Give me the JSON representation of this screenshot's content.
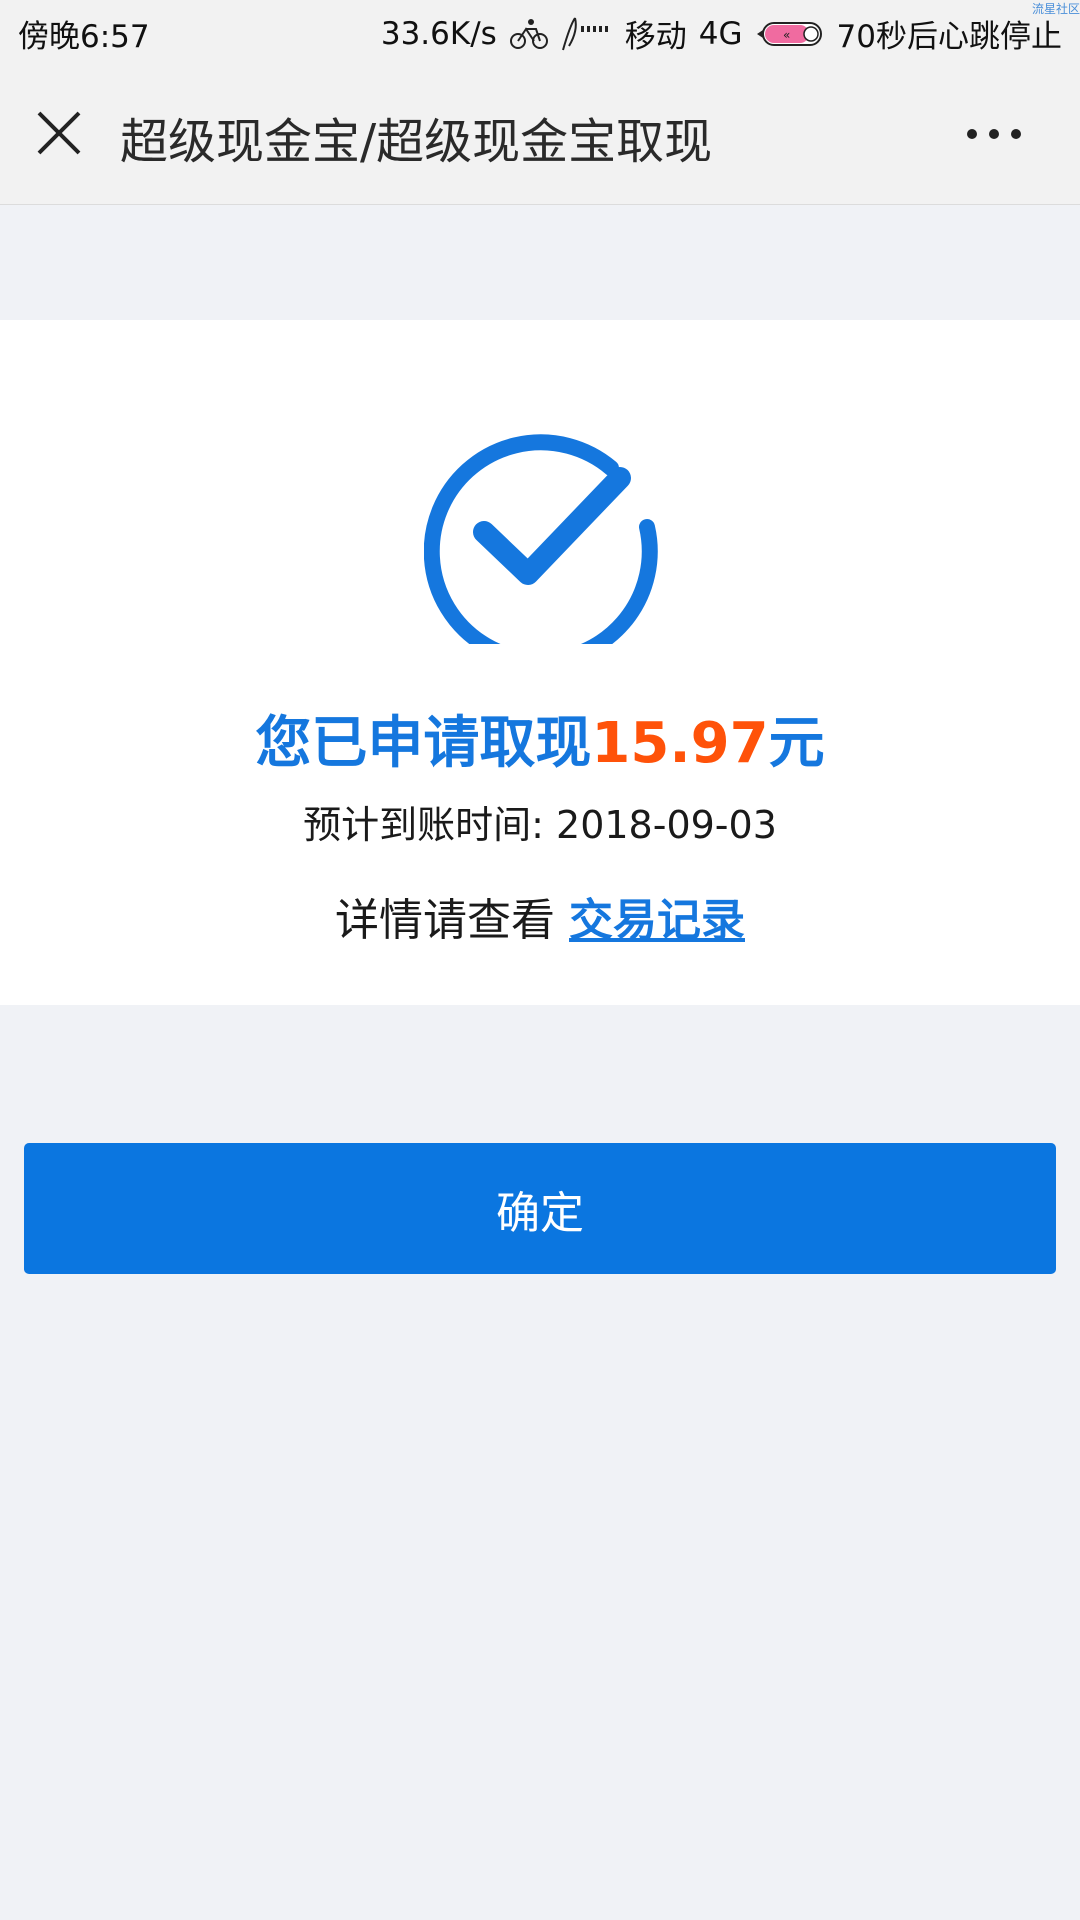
{
  "status_bar": {
    "time": "傍晚6:57",
    "speed": "33.6K/s",
    "carrier": "移动",
    "network": "4G",
    "heart_text": "70秒后心跳停止",
    "watermark": "流星社区",
    "icons": [
      "bicycle-icon",
      "signal-icon",
      "battery-icon"
    ]
  },
  "nav": {
    "title": "超级现金宝/超级现金宝取现",
    "close_icon": "close-icon",
    "more_icon": "more-icon"
  },
  "result": {
    "headline_prefix": "您已申请取现",
    "amount": "15.97",
    "currency": "元",
    "eta_label": "预计到账时间:",
    "eta_date": "2018-09-03",
    "details_text": "详情请查看",
    "details_link": "交易记录",
    "icon": "check-circle-icon"
  },
  "actions": {
    "confirm_label": "确定"
  },
  "colors": {
    "accent": "#1577de",
    "amount": "#ff5209",
    "button": "#0b76e0",
    "background": "#f0f2f6"
  }
}
